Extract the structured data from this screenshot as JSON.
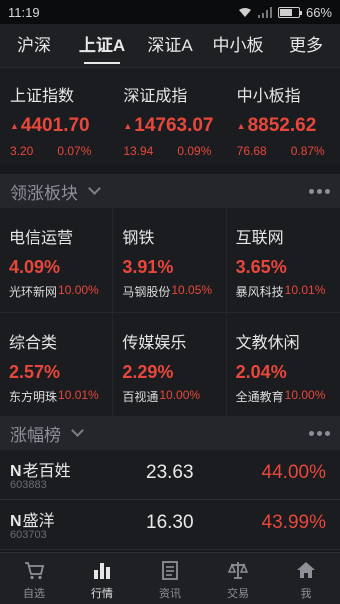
{
  "status": {
    "time": "11:19",
    "battery": "66%",
    "battery_level": 0.66
  },
  "tabs": [
    {
      "label": "沪深"
    },
    {
      "label": "上证A"
    },
    {
      "label": "深证A"
    },
    {
      "label": "中小板"
    },
    {
      "label": "更多"
    }
  ],
  "indices": [
    {
      "name": "上证指数",
      "value": "4401.70",
      "change": "3.20",
      "pct": "0.07%"
    },
    {
      "name": "深证成指",
      "value": "14763.07",
      "change": "13.94",
      "pct": "0.09%"
    },
    {
      "name": "中小板指",
      "value": "8852.62",
      "change": "76.68",
      "pct": "0.87%"
    }
  ],
  "sectors_header": {
    "title": "领涨板块"
  },
  "sectors": [
    {
      "name": "电信运营",
      "pct": "4.09%",
      "leader": "光环新网",
      "leader_pct": "10.00%"
    },
    {
      "name": "钢铁",
      "pct": "3.91%",
      "leader": "马钢股份",
      "leader_pct": "10.05%"
    },
    {
      "name": "互联网",
      "pct": "3.65%",
      "leader": "暴风科技",
      "leader_pct": "10.01%"
    },
    {
      "name": "综合类",
      "pct": "2.57%",
      "leader": "东方明珠",
      "leader_pct": "10.01%"
    },
    {
      "name": "传媒娱乐",
      "pct": "2.29%",
      "leader": "百视通",
      "leader_pct": "10.00%"
    },
    {
      "name": "文教休闲",
      "pct": "2.04%",
      "leader": "全通教育",
      "leader_pct": "10.00%"
    }
  ],
  "gainers_header": {
    "title": "涨幅榜"
  },
  "gainers": [
    {
      "prefix": "N",
      "name": "老百姓",
      "code": "603883",
      "price": "23.63",
      "pct": "44.00%"
    },
    {
      "prefix": "N",
      "name": "盛洋",
      "code": "603703",
      "price": "16.30",
      "pct": "43.99%"
    }
  ],
  "bottom_nav": [
    {
      "label": "自选",
      "icon": "cart-icon"
    },
    {
      "label": "行情",
      "icon": "bar-chart-icon"
    },
    {
      "label": "资讯",
      "icon": "news-icon"
    },
    {
      "label": "交易",
      "icon": "scale-icon"
    },
    {
      "label": "我",
      "icon": "home-icon"
    }
  ],
  "colors": {
    "up": "#e8473b",
    "bg": "#17191d"
  }
}
